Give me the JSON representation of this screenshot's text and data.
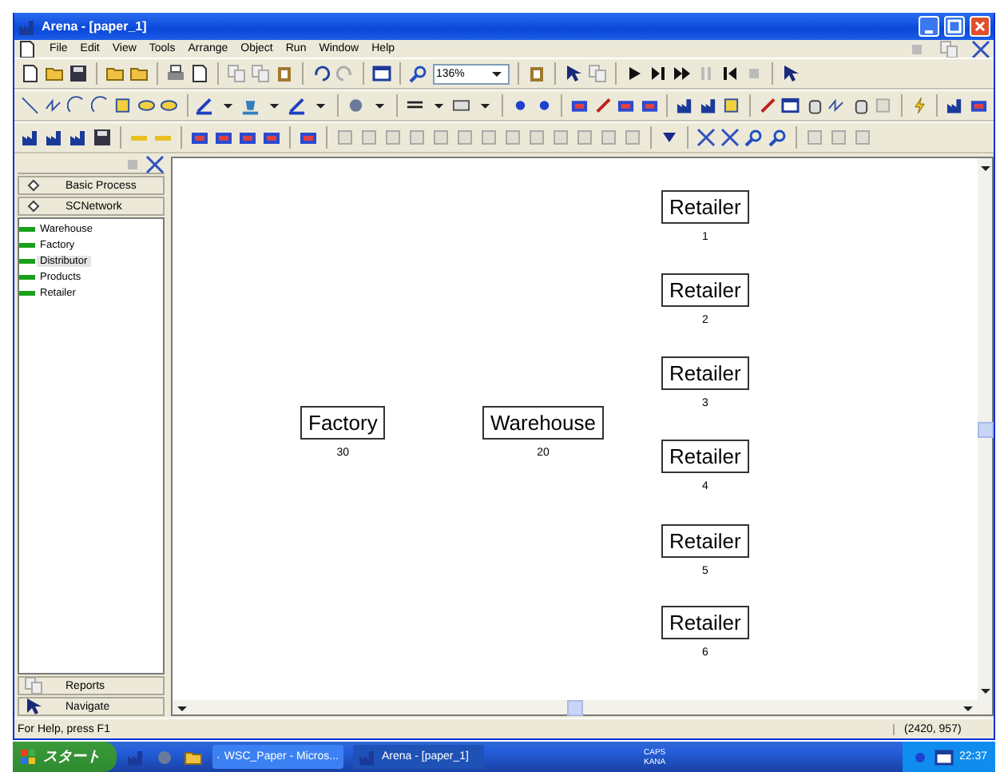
{
  "window": {
    "title": "Arena - [paper_1]"
  },
  "menu": [
    "File",
    "Edit",
    "View",
    "Tools",
    "Arrange",
    "Object",
    "Run",
    "Window",
    "Help"
  ],
  "zoom": {
    "value": "136%"
  },
  "project_bar": {
    "panels": [
      "Basic Process",
      "SCNetwork"
    ],
    "items": [
      {
        "label": "Warehouse",
        "selected": false
      },
      {
        "label": "Factory",
        "selected": false
      },
      {
        "label": "Distributor",
        "selected": true
      },
      {
        "label": "Products",
        "selected": false
      },
      {
        "label": "Retailer",
        "selected": false
      }
    ],
    "bottom_panels": [
      "Reports",
      "Navigate"
    ]
  },
  "canvas": {
    "modules": [
      {
        "name": "Factory",
        "number": "30"
      },
      {
        "name": "Warehouse",
        "number": "20"
      },
      {
        "name": "Retailer",
        "number": "1"
      },
      {
        "name": "Retailer",
        "number": "2"
      },
      {
        "name": "Retailer",
        "number": "3"
      },
      {
        "name": "Retailer",
        "number": "4"
      },
      {
        "name": "Retailer",
        "number": "5"
      },
      {
        "name": "Retailer",
        "number": "6"
      }
    ]
  },
  "status_bar": {
    "message": "For Help, press F1",
    "coordinates": "(2420, 957)"
  },
  "taskbar": {
    "start": "スタート",
    "tasks": [
      {
        "label": "WSC_Paper - Micros...",
        "selected": false
      },
      {
        "label": "Arena - [paper_1]",
        "selected": true
      }
    ],
    "tray": [
      "CAPS",
      "KANA"
    ],
    "clock": "22:37"
  }
}
